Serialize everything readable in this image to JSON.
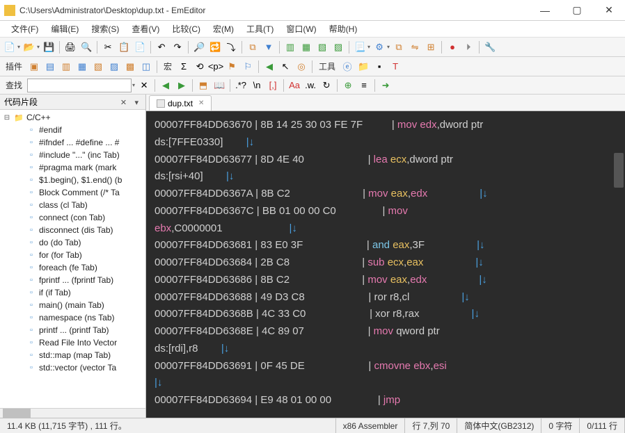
{
  "title": "C:\\Users\\Administrator\\Desktop\\dup.txt - EmEditor",
  "menu": [
    "文件(F)",
    "编辑(E)",
    "搜索(S)",
    "查看(V)",
    "比较(C)",
    "宏(M)",
    "工具(T)",
    "窗口(W)",
    "帮助(H)"
  ],
  "toolbar2": {
    "label_plugins": "插件",
    "label_macro": "宏",
    "label_tools": "工具"
  },
  "search": {
    "label": "查找",
    "value": ""
  },
  "sidebar": {
    "title": "代码片段",
    "root": "C/C++",
    "items": [
      "#endif",
      "#ifndef ... #define ... #",
      "#include \"...\"  (inc Tab)",
      "#pragma mark  (mark",
      "$1.begin(), $1.end()   (b",
      "Block Comment  (/* Ta",
      "class   (cl Tab)",
      "connect  (con Tab)",
      "disconnect  (dis Tab)",
      "do  (do Tab)",
      "for  (for Tab)",
      "foreach  (fe Tab)",
      "fprintf ...  (fprintf Tab)",
      "if  (if Tab)",
      "main()  (main Tab)",
      "namespace  (ns Tab)",
      "printf ...  (printf Tab)",
      "Read File Into Vector",
      "std::map  (map Tab)",
      "std::vector  (vector Ta"
    ]
  },
  "tab": {
    "name": "dup.txt"
  },
  "code": [
    {
      "addr": "00007FF84DD63670",
      "bytes": "8B 14 25 30 03 FE 7F",
      "mnem": "mov",
      "mc": "op-mov",
      "arg1": "edx",
      "a1c": "reg-edx",
      "rest": ",dword ptr"
    },
    {
      "cont": "ds:[7FFE0330]",
      "arrow": "|↓"
    },
    {
      "addr": "00007FF84DD63677",
      "bytes": "8D 4E 40",
      "mnem": "lea",
      "mc": "op-lea",
      "arg1": "ecx",
      "a1c": "reg-ecx",
      "rest": ",dword ptr"
    },
    {
      "cont": "ds:[rsi+40]",
      "arrow": "|↓"
    },
    {
      "addr": "00007FF84DD6367A",
      "bytes": "8B C2",
      "mnem": "mov",
      "mc": "op-mov",
      "arg1": "eax",
      "a1c": "reg-eax",
      "comma": ",",
      "arg2": "edx",
      "a2c": "reg-edx",
      "tail": "|↓"
    },
    {
      "addr": "00007FF84DD6367C",
      "bytes": "BB 01 00 00 C0",
      "mnem": "mov",
      "mc": "op-mov"
    },
    {
      "contreg": "ebx",
      "contregc": "reg-ebx",
      "conttxt": ",C0000001",
      "arrow": "|↓"
    },
    {
      "addr": "00007FF84DD63681",
      "bytes": "83 E0 3F",
      "mnem": "and",
      "mc": "op-and",
      "arg1": "eax",
      "a1c": "reg-eax",
      "rest": ",3F",
      "tail": "|↓"
    },
    {
      "addr": "00007FF84DD63684",
      "bytes": "2B C8",
      "mnem": "sub",
      "mc": "op-sub",
      "arg1": "ecx",
      "a1c": "reg-ecx",
      "comma": ",",
      "arg2": "eax",
      "a2c": "reg-eax",
      "tail": "|↓"
    },
    {
      "addr": "00007FF84DD63686",
      "bytes": "8B C2",
      "mnem": "mov",
      "mc": "op-mov",
      "arg1": "eax",
      "a1c": "reg-eax",
      "comma": ",",
      "arg2": "edx",
      "a2c": "reg-edx",
      "tail": "|↓"
    },
    {
      "addr": "00007FF84DD63688",
      "bytes": "49 D3 C8",
      "mnem": "ror",
      "mc": "op-ror",
      "arg1": "r8",
      "a1c": "reg-r8",
      "rest": ",cl",
      "tail": "|↓"
    },
    {
      "addr": "00007FF84DD6368B",
      "bytes": "4C 33 C0",
      "mnem": "xor",
      "mc": "op-xor",
      "arg1": "r8",
      "a1c": "reg-r8",
      "rest": ",rax",
      "tail": "|↓"
    },
    {
      "addr": "00007FF84DD6368E",
      "bytes": "4C 89 07",
      "mnem": "mov",
      "mc": "op-mov",
      "rest2": "qword ptr"
    },
    {
      "cont": "ds:[rdi],r8",
      "arrow": "|↓"
    },
    {
      "addr": "00007FF84DD63691",
      "bytes": "0F 45 DE",
      "mnem": "cmovne",
      "mc": "op-cmov",
      "arg1": "ebx",
      "a1c": "reg-ebx",
      "comma": ",",
      "arg2": "esi",
      "a2c": "reg-esi"
    },
    {
      "arrow": "|↓"
    },
    {
      "addr": "00007FF84DD63694",
      "bytes": "E9 48 01 00 00",
      "mnem": "jmp",
      "mc": "op-jmp"
    }
  ],
  "status": {
    "left": "11.4 KB (11,715 字节) , 111 行。",
    "lang": "x86 Assembler",
    "pos": "行 7,列 70",
    "enc": "简体中文(GB2312)",
    "sel": "0 字符",
    "lines": "0/111 行"
  }
}
